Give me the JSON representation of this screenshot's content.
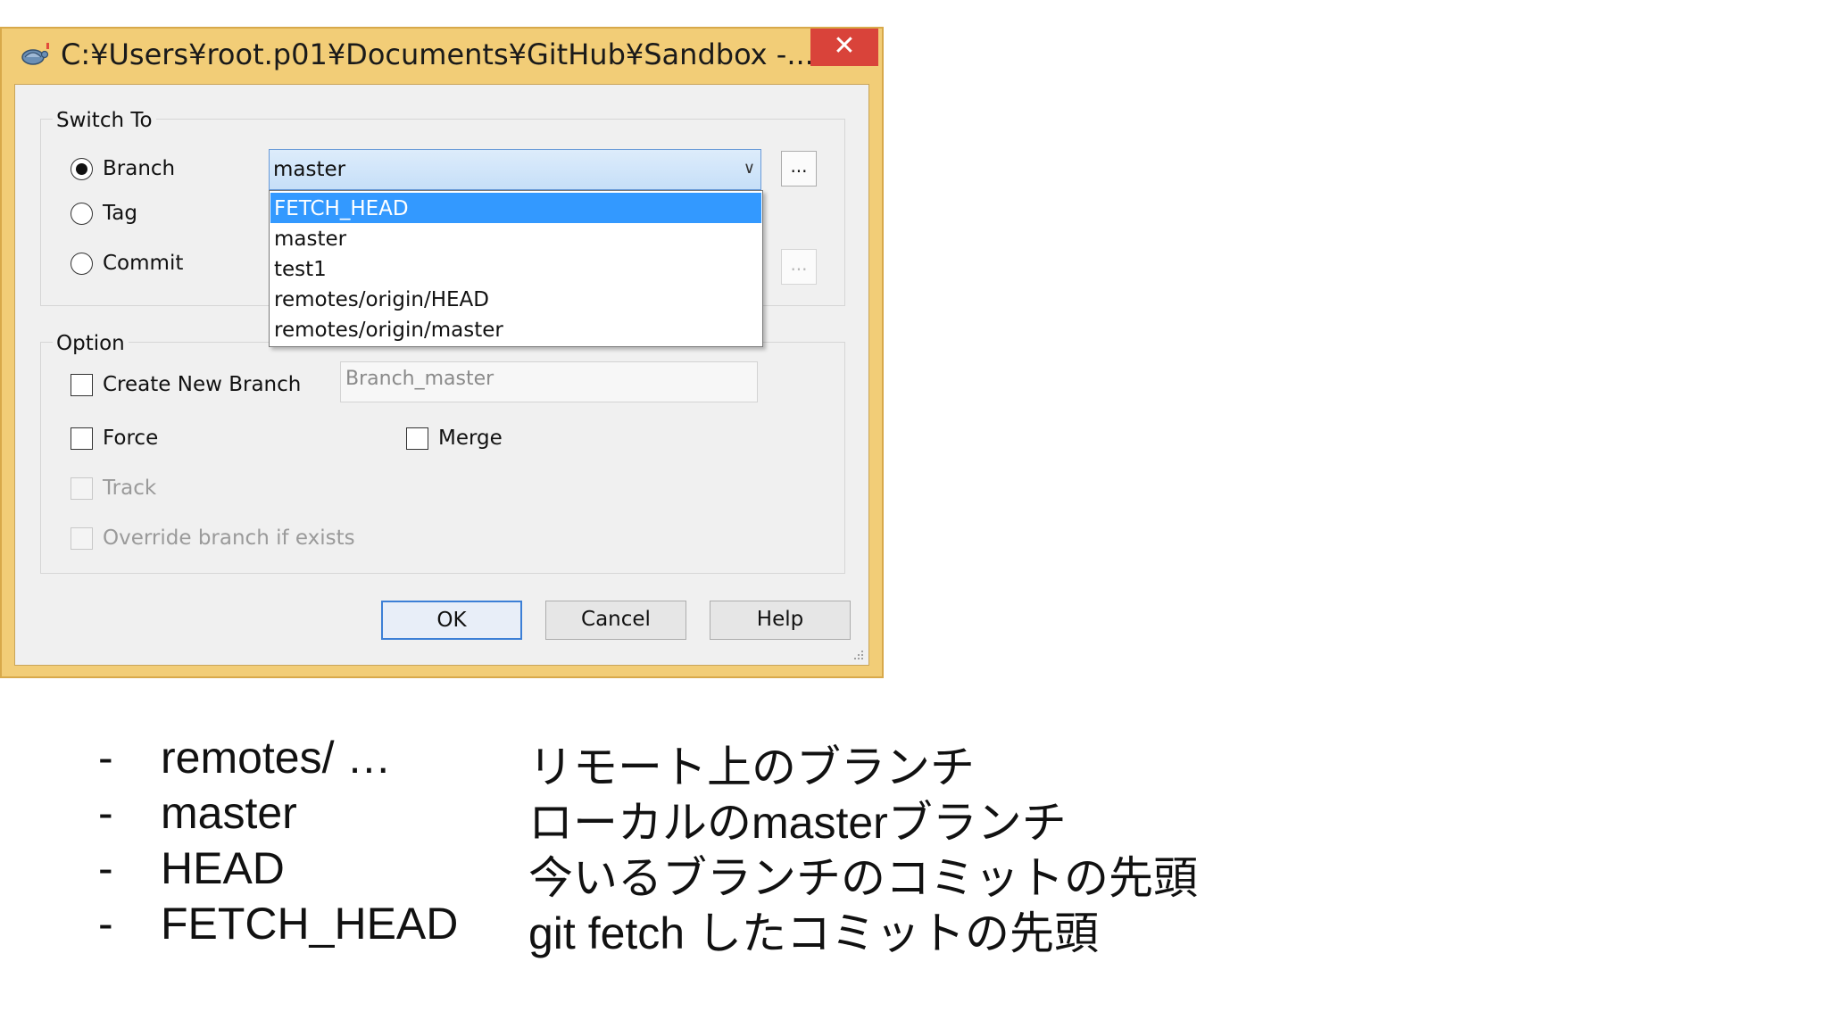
{
  "window": {
    "title": "C:¥Users¥root.p01¥Documents¥GitHub¥Sandbox -...",
    "close_glyph": "✕",
    "colors": {
      "frame": "#f2cd77",
      "close": "#d9433a",
      "selection": "#3399ff"
    }
  },
  "switch_to": {
    "label": "Switch To",
    "branch_label": "Branch",
    "tag_label": "Tag",
    "commit_label": "Commit",
    "selected": "branch",
    "branch_value": "master",
    "browse_label": "...",
    "dropdown_options": [
      "FETCH_HEAD",
      "master",
      "test1",
      "remotes/origin/HEAD",
      "remotes/origin/master"
    ],
    "highlighted_option": "FETCH_HEAD"
  },
  "option": {
    "label": "Option",
    "create_new_branch_label": "Create New Branch",
    "new_branch_placeholder": "Branch_master",
    "force_label": "Force",
    "merge_label": "Merge",
    "track_label": "Track",
    "override_label": "Override branch if exists"
  },
  "buttons": {
    "ok": "OK",
    "cancel": "Cancel",
    "help": "Help"
  },
  "notes": [
    {
      "bullet": "-",
      "term": "remotes/ …",
      "desc": "リモート上のブランチ"
    },
    {
      "bullet": "-",
      "term": "master",
      "desc": "ローカルのmasterブランチ"
    },
    {
      "bullet": "-",
      "term": "HEAD",
      "desc": "今いるブランチのコミットの先頭"
    },
    {
      "bullet": "-",
      "term": "FETCH_HEAD",
      "desc": "git fetch したコミットの先頭"
    }
  ]
}
